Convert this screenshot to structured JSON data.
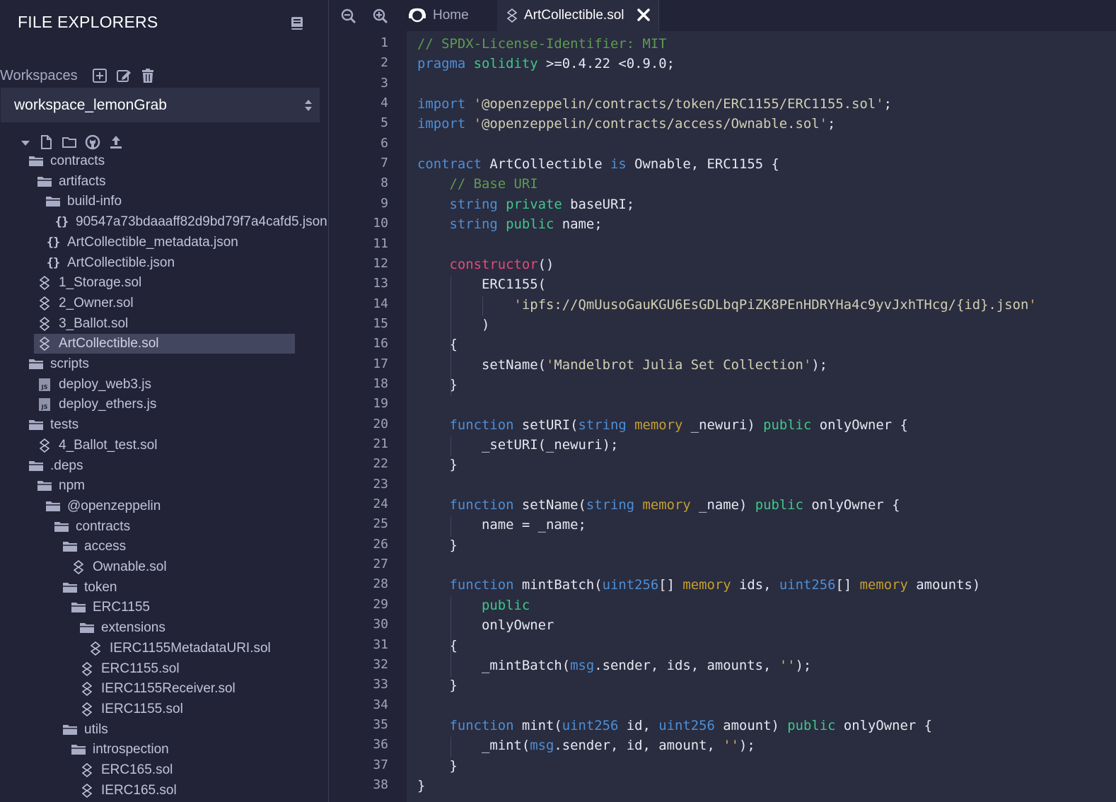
{
  "sidebar": {
    "title": "FILE EXPLORERS",
    "workspaces_label": "Workspaces",
    "workspace_selected": "workspace_lemonGrab",
    "tree": [
      {
        "label": "contracts",
        "type": "folder",
        "depth": 0
      },
      {
        "label": "artifacts",
        "type": "folder",
        "depth": 1
      },
      {
        "label": "build-info",
        "type": "folder",
        "depth": 2
      },
      {
        "label": "90547a73bdaaaff82d9bd79f7a4cafd5.json",
        "type": "json",
        "depth": 3
      },
      {
        "label": "ArtCollectible_metadata.json",
        "type": "json",
        "depth": 2
      },
      {
        "label": "ArtCollectible.json",
        "type": "json",
        "depth": 2
      },
      {
        "label": "1_Storage.sol",
        "type": "sol",
        "depth": 1
      },
      {
        "label": "2_Owner.sol",
        "type": "sol",
        "depth": 1
      },
      {
        "label": "3_Ballot.sol",
        "type": "sol",
        "depth": 1
      },
      {
        "label": "ArtCollectible.sol",
        "type": "sol",
        "depth": 1,
        "selected": true
      },
      {
        "label": "scripts",
        "type": "folder",
        "depth": 0
      },
      {
        "label": "deploy_web3.js",
        "type": "js",
        "depth": 1
      },
      {
        "label": "deploy_ethers.js",
        "type": "js",
        "depth": 1
      },
      {
        "label": "tests",
        "type": "folder",
        "depth": 0
      },
      {
        "label": "4_Ballot_test.sol",
        "type": "sol",
        "depth": 1
      },
      {
        "label": ".deps",
        "type": "folder",
        "depth": 0
      },
      {
        "label": "npm",
        "type": "folder",
        "depth": 1
      },
      {
        "label": "@openzeppelin",
        "type": "folder",
        "depth": 2
      },
      {
        "label": "contracts",
        "type": "folder",
        "depth": 3
      },
      {
        "label": "access",
        "type": "folder",
        "depth": 4
      },
      {
        "label": "Ownable.sol",
        "type": "sol",
        "depth": 5
      },
      {
        "label": "token",
        "type": "folder",
        "depth": 4
      },
      {
        "label": "ERC1155",
        "type": "folder",
        "depth": 5
      },
      {
        "label": "extensions",
        "type": "folder",
        "depth": 6
      },
      {
        "label": "IERC1155MetadataURI.sol",
        "type": "sol",
        "depth": 7
      },
      {
        "label": "ERC1155.sol",
        "type": "sol",
        "depth": 6
      },
      {
        "label": "IERC1155Receiver.sol",
        "type": "sol",
        "depth": 6
      },
      {
        "label": "IERC1155.sol",
        "type": "sol",
        "depth": 6
      },
      {
        "label": "utils",
        "type": "folder",
        "depth": 4
      },
      {
        "label": "introspection",
        "type": "folder",
        "depth": 5
      },
      {
        "label": "ERC165.sol",
        "type": "sol",
        "depth": 6
      },
      {
        "label": "IERC165.sol",
        "type": "sol",
        "depth": 6
      }
    ]
  },
  "editor": {
    "tabs": {
      "home": "Home",
      "active": "ArtCollectible.sol"
    },
    "code_lines": [
      [
        [
          "cm",
          "// SPDX-License-Identifier: MIT"
        ]
      ],
      [
        [
          "kw",
          "pragma"
        ],
        [
          "p",
          " "
        ],
        [
          "mod",
          "solidity"
        ],
        [
          "p",
          " >=0.4.22 <0.9.0;"
        ]
      ],
      [],
      [
        [
          "kw",
          "import"
        ],
        [
          "p",
          " "
        ],
        [
          "q",
          "'"
        ],
        [
          "str",
          "@openzeppelin/contracts/token/ERC1155/ERC1155.sol"
        ],
        [
          "q",
          "'"
        ],
        [
          "p",
          ";"
        ]
      ],
      [
        [
          "kw",
          "import"
        ],
        [
          "p",
          " "
        ],
        [
          "q",
          "'"
        ],
        [
          "str",
          "@openzeppelin/contracts/access/Ownable.sol"
        ],
        [
          "q",
          "'"
        ],
        [
          "p",
          ";"
        ]
      ],
      [],
      [
        [
          "kw",
          "contract"
        ],
        [
          "p",
          " ArtCollectible "
        ],
        [
          "kw",
          "is"
        ],
        [
          "p",
          " Ownable, ERC1155 {"
        ]
      ],
      [
        [
          "p",
          "    "
        ],
        [
          "cm",
          "// Base URI"
        ]
      ],
      [
        [
          "p",
          "    "
        ],
        [
          "ty",
          "string"
        ],
        [
          "p",
          " "
        ],
        [
          "mod",
          "private"
        ],
        [
          "p",
          " baseURI;"
        ]
      ],
      [
        [
          "p",
          "    "
        ],
        [
          "ty",
          "string"
        ],
        [
          "p",
          " "
        ],
        [
          "mod",
          "public"
        ],
        [
          "p",
          " name;"
        ]
      ],
      [],
      [
        [
          "p",
          "    "
        ],
        [
          "ctor",
          "constructor"
        ],
        [
          "p",
          "()"
        ]
      ],
      [
        [
          "p",
          "        ERC1155("
        ]
      ],
      [
        [
          "p",
          "            "
        ],
        [
          "q",
          "'"
        ],
        [
          "str",
          "ipfs://QmUusoGauKGU6EsGDLbqPiZK8PEnHDRYHa4c9yvJxhTHcg/{id}.json"
        ],
        [
          "q",
          "'"
        ]
      ],
      [
        [
          "p",
          "        )"
        ]
      ],
      [
        [
          "p",
          "    {"
        ]
      ],
      [
        [
          "p",
          "        setName("
        ],
        [
          "q",
          "'"
        ],
        [
          "str",
          "Mandelbrot Julia Set Collection"
        ],
        [
          "q",
          "'"
        ],
        [
          "p",
          ");"
        ]
      ],
      [
        [
          "p",
          "    }"
        ]
      ],
      [],
      [
        [
          "p",
          "    "
        ],
        [
          "kw",
          "function"
        ],
        [
          "p",
          " setURI("
        ],
        [
          "ty",
          "string"
        ],
        [
          "p",
          " "
        ],
        [
          "mem",
          "memory"
        ],
        [
          "p",
          " _newuri) "
        ],
        [
          "mod",
          "public"
        ],
        [
          "p",
          " onlyOwner {"
        ]
      ],
      [
        [
          "p",
          "        _setURI(_newuri);"
        ]
      ],
      [
        [
          "p",
          "    }"
        ]
      ],
      [],
      [
        [
          "p",
          "    "
        ],
        [
          "kw",
          "function"
        ],
        [
          "p",
          " setName("
        ],
        [
          "ty",
          "string"
        ],
        [
          "p",
          " "
        ],
        [
          "mem",
          "memory"
        ],
        [
          "p",
          " _name) "
        ],
        [
          "mod",
          "public"
        ],
        [
          "p",
          " onlyOwner {"
        ]
      ],
      [
        [
          "p",
          "        name = _name;"
        ]
      ],
      [
        [
          "p",
          "    }"
        ]
      ],
      [],
      [
        [
          "p",
          "    "
        ],
        [
          "kw",
          "function"
        ],
        [
          "p",
          " mintBatch("
        ],
        [
          "ty",
          "uint256"
        ],
        [
          "p",
          "[] "
        ],
        [
          "mem",
          "memory"
        ],
        [
          "p",
          " ids, "
        ],
        [
          "ty",
          "uint256"
        ],
        [
          "p",
          "[] "
        ],
        [
          "mem",
          "memory"
        ],
        [
          "p",
          " amounts)"
        ]
      ],
      [
        [
          "p",
          "        "
        ],
        [
          "mod",
          "public"
        ]
      ],
      [
        [
          "p",
          "        onlyOwner"
        ]
      ],
      [
        [
          "p",
          "    {"
        ]
      ],
      [
        [
          "p",
          "        _mintBatch("
        ],
        [
          "ty",
          "msg"
        ],
        [
          "p",
          ".sender, ids, amounts, "
        ],
        [
          "q",
          "''"
        ],
        [
          "p",
          ");"
        ]
      ],
      [
        [
          "p",
          "    }"
        ]
      ],
      [],
      [
        [
          "p",
          "    "
        ],
        [
          "kw",
          "function"
        ],
        [
          "p",
          " mint("
        ],
        [
          "ty",
          "uint256"
        ],
        [
          "p",
          " id, "
        ],
        [
          "ty",
          "uint256"
        ],
        [
          "p",
          " amount) "
        ],
        [
          "mod",
          "public"
        ],
        [
          "p",
          " onlyOwner {"
        ]
      ],
      [
        [
          "p",
          "        _mint("
        ],
        [
          "ty",
          "msg"
        ],
        [
          "p",
          ".sender, id, amount, "
        ],
        [
          "q",
          "''"
        ],
        [
          "p",
          ");"
        ]
      ],
      [
        [
          "p",
          "    }"
        ]
      ],
      [
        [
          "p",
          "}"
        ]
      ]
    ]
  },
  "colors": {
    "sidebar_bg": "#222336",
    "editor_bg": "#2a2c3f",
    "selected_bg": "#43465f",
    "keyword": "#4d8fd6",
    "modifier": "#3ec88a",
    "memory": "#c4a02f",
    "comment": "#5d9c52",
    "constructor": "#e04d7e"
  },
  "icons": {
    "book": "book-icon",
    "create_workspace": "plus-square-icon",
    "rename_workspace": "edit-icon",
    "delete_workspace": "trash-icon",
    "zoom_out": "zoom-out-icon",
    "zoom_in": "zoom-in-icon",
    "home": "remix-logo-icon",
    "solidity": "solidity-icon",
    "close": "close-icon"
  }
}
